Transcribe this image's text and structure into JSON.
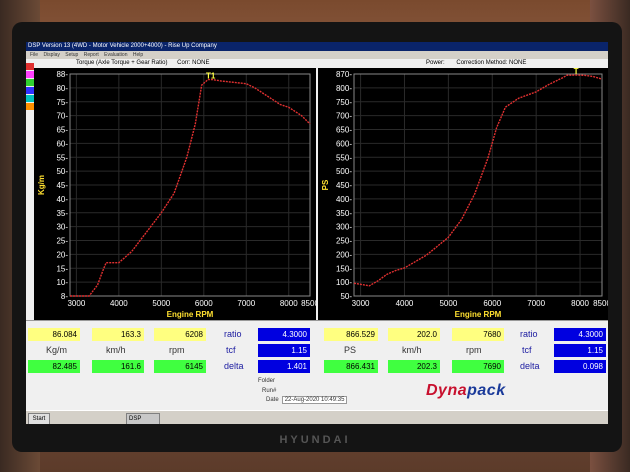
{
  "window": {
    "title": "DSP Version 13 (4WD - Motor Vehicle 2000+4000) - Rise Up Company"
  },
  "menu": [
    "File",
    "Display",
    "Setup",
    "Report",
    "Evaluation",
    "Help"
  ],
  "charts": {
    "torque": {
      "header_title": "Torque (Axle Torque + Gear Ratio)",
      "header_corr": "Corr: NONE",
      "ylabel": "Kg/m",
      "xlabel": "Engine RPM",
      "y_ticks": [
        "88-",
        "80-",
        "75-",
        "70-",
        "65-",
        "60-",
        "55-",
        "50-",
        "45-",
        "40-",
        "35-",
        "30-",
        "25-",
        "20-",
        "15-",
        "10-",
        "8-"
      ],
      "x_ticks": [
        "3000",
        "4000",
        "5000",
        "6000",
        "7000",
        "8000",
        "8500"
      ],
      "marker": "T1",
      "color": "#e03030"
    },
    "power": {
      "header_title": "Power:",
      "header_corr": "Correction Method: NONE",
      "ylabel": "PS",
      "xlabel": "Engine RPM",
      "y_ticks": [
        "870-",
        "800-",
        "750-",
        "700-",
        "650-",
        "600-",
        "550-",
        "500-",
        "450-",
        "400-",
        "350-",
        "300-",
        "250-",
        "200-",
        "150-",
        "100-",
        "50-"
      ],
      "x_ticks": [
        "3000",
        "4000",
        "5000",
        "6000",
        "7000",
        "8000",
        "8500"
      ],
      "marker": "T",
      "color": "#e03030"
    }
  },
  "chart_data": [
    {
      "type": "line",
      "title": "Torque (Axle Torque + Gear Ratio)",
      "xlabel": "Engine RPM",
      "ylabel": "Kg/m",
      "xlim": [
        2850,
        8500
      ],
      "ylim": [
        8,
        88
      ],
      "series": [
        {
          "x": [
            2850,
            3300,
            3500,
            3620,
            3700,
            3800,
            4000,
            4300,
            4700,
            5000,
            5300,
            5600,
            5800,
            5950,
            6100,
            6200,
            6400,
            6700,
            7000,
            7200,
            7500,
            7800,
            8000,
            8300,
            8500
          ],
          "values": [
            8,
            8,
            12,
            17,
            20,
            20,
            20,
            24,
            32,
            38,
            45,
            58,
            70,
            84,
            86,
            86,
            85.5,
            85,
            84.5,
            83,
            80,
            77,
            76,
            73,
            70
          ]
        }
      ]
    },
    {
      "type": "line",
      "title": "Power",
      "xlabel": "Engine RPM",
      "ylabel": "PS",
      "xlim": [
        2850,
        8500
      ],
      "ylim": [
        0,
        870
      ],
      "series": [
        {
          "x": [
            2850,
            3200,
            3400,
            3600,
            3800,
            4000,
            4500,
            5000,
            5300,
            5600,
            5900,
            6100,
            6300,
            6600,
            7000,
            7300,
            7600,
            7700,
            7900,
            8100,
            8300,
            8500
          ],
          "values": [
            50,
            40,
            60,
            85,
            100,
            110,
            160,
            230,
            300,
            400,
            540,
            660,
            740,
            775,
            800,
            830,
            855,
            865,
            866,
            865,
            860,
            850
          ]
        }
      ]
    }
  ],
  "readouts": {
    "left": {
      "row1": [
        "86.084",
        "163.3",
        "6208"
      ],
      "units": [
        "Kg/m",
        "km/h",
        "rpm"
      ],
      "row2": [
        "82.485",
        "161.6",
        "6145"
      ],
      "ratio_label": "ratio",
      "ratio_val": "4.3000",
      "tcf_label": "tcf",
      "tcf_val": "1.15",
      "delta_label": "delta",
      "delta_val": "1.401"
    },
    "right": {
      "row1": [
        "866.529",
        "202.0",
        "7680"
      ],
      "units": [
        "PS",
        "km/h",
        "rpm"
      ],
      "row2": [
        "866.431",
        "202.3",
        "7690"
      ],
      "ratio_label": "ratio",
      "ratio_val": "4.3000",
      "tcf_label": "tcf",
      "tcf_val": "1.15",
      "delta_label": "delta",
      "delta_val": "0.098"
    }
  },
  "info": {
    "folder_label": "Folder",
    "run_label": "Run#",
    "date_label": "Date",
    "date_value": "22-Aug-2020 10:49:35"
  },
  "logo": {
    "part1": "Dyna",
    "part2": "pack"
  },
  "taskbar": {
    "start": "Start",
    "task": "DSP"
  },
  "monitor_brand": "HYUNDAI"
}
